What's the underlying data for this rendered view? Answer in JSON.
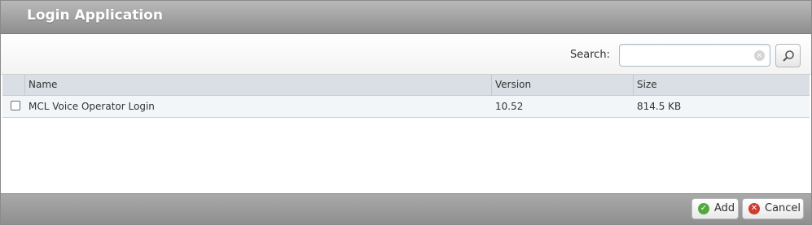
{
  "dialog": {
    "title": "Login Application"
  },
  "search": {
    "label": "Search:",
    "value": "",
    "placeholder": ""
  },
  "table": {
    "columns": [
      "Name",
      "Version",
      "Size"
    ],
    "rows": [
      {
        "checked": false,
        "name": "MCL Voice Operator Login",
        "version": "10.52",
        "size": "814.5 KB"
      }
    ]
  },
  "footer": {
    "add_label": "Add",
    "cancel_label": "Cancel"
  },
  "colors": {
    "titlebar": "#9f9f9f",
    "header_bg": "#d9dfe4",
    "row_bg": "#f3f6f8",
    "add_icon": "#53a93f",
    "cancel_icon": "#cf3b2c"
  },
  "icons": {
    "search": "search-icon",
    "clear": "clear-icon",
    "add": "check-circle-icon",
    "cancel": "x-circle-icon"
  }
}
